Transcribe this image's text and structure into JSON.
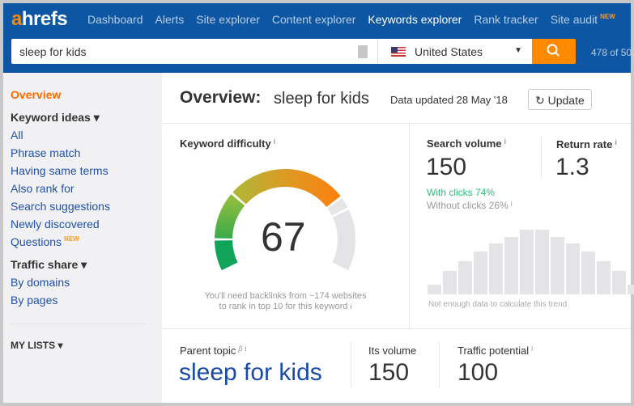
{
  "header": {
    "logo": "ahrefs",
    "nav": [
      {
        "label": "Dashboard"
      },
      {
        "label": "Alerts"
      },
      {
        "label": "Site explorer"
      },
      {
        "label": "Content explorer"
      },
      {
        "label": "Keywords explorer",
        "active": true
      },
      {
        "label": "Rank tracker"
      },
      {
        "label": "Site audit",
        "badge": "NEW"
      }
    ],
    "search_value": "sleep for kids",
    "country": "United States",
    "count": "478 of 50"
  },
  "sidebar": {
    "overview": "Overview",
    "keyword_ideas": "Keyword ideas ▾",
    "ideas": [
      "All",
      "Phrase match",
      "Having same terms",
      "Also rank for",
      "Search suggestions",
      "Newly discovered",
      "Questions"
    ],
    "questions_badge": "NEW",
    "traffic_share": "Traffic share ▾",
    "traffic": [
      "By domains",
      "By pages"
    ],
    "my_lists": "MY LISTS ▾"
  },
  "overview": {
    "title": "Overview:",
    "keyword": "sleep for kids",
    "updated": "Data updated 28 May '18",
    "update_button": "Update"
  },
  "kd": {
    "label": "Keyword difficulty",
    "value": "67",
    "note1": "You'll need backlinks from ~174 websites",
    "note2": "to rank in top 10 for this keyword",
    "score": 67
  },
  "volume": {
    "label": "Search volume",
    "value": "150",
    "with_clicks": "With clicks 74%",
    "without_clicks": "Without clicks 26%",
    "trend_note": "Not enough data to calculate this trend"
  },
  "return_rate": {
    "label": "Return rate",
    "value": "1.3"
  },
  "parent": {
    "label": "Parent topic",
    "beta": "β",
    "value": "sleep for kids",
    "volume_label": "Its volume",
    "volume": "150",
    "traffic_label": "Traffic potential",
    "traffic": "100"
  },
  "colors": {
    "header": "#0c56a3",
    "accent": "#ff8a00",
    "link": "#2150a8",
    "green": "#27c27a"
  }
}
